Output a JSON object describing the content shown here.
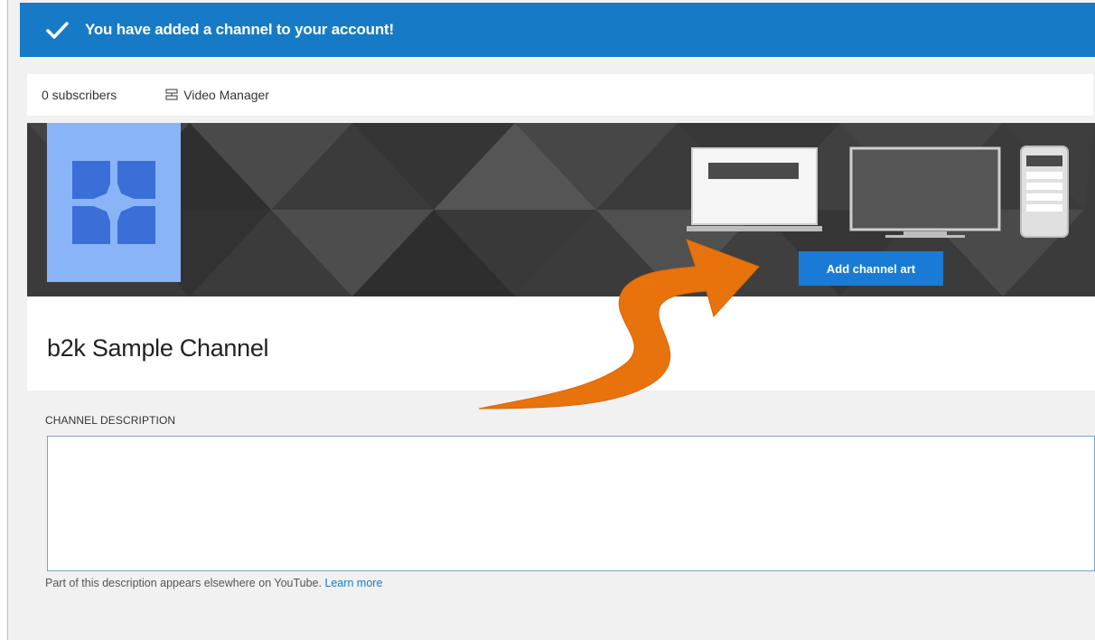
{
  "notice": {
    "message": "You have added a channel to your account!",
    "icon": "check-icon",
    "color": "#167ac6"
  },
  "meta": {
    "subscribers": "0 subscribers",
    "video_manager": "Video Manager"
  },
  "banner": {
    "add_art_label": "Add channel art",
    "button_color": "#1a7bd6"
  },
  "channel": {
    "name": "b2k Sample Channel"
  },
  "description": {
    "label": "CHANNEL DESCRIPTION",
    "value": "",
    "help_text": "Part of this description appears elsewhere on YouTube.",
    "learn_more": "Learn more"
  },
  "annotation": {
    "arrow_color": "#e8720c"
  }
}
